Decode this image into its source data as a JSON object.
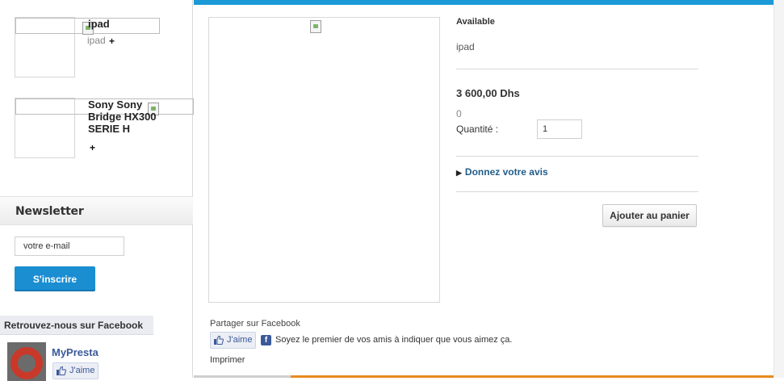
{
  "sidebar": {
    "products": [
      {
        "title": "ipad",
        "subtitle": "ipad",
        "action": "+"
      },
      {
        "title": "Sony Sony Bridge HX300 SERIE H",
        "action": "+"
      }
    ],
    "newsletter": {
      "title": "Newsletter",
      "email_value": "votre e-mail",
      "subscribe_label": "S'inscrire"
    },
    "facebook": {
      "title": "Retrouvez-nous sur Facebook",
      "page_name": "MyPresta",
      "like_label": "J'aime"
    }
  },
  "product": {
    "availability": "Available",
    "short_description": "ipad",
    "price": "3 600,00 Dhs",
    "reference": "0",
    "quantity_label": "Quantité :",
    "quantity_value": "1",
    "review_link": "Donnez votre avis",
    "add_to_cart": "Ajouter au panier"
  },
  "share": {
    "label": "Partager sur Facebook",
    "like_label": "J'aime",
    "social_text": "Soyez le premier de vos amis à indiquer que vous aimez ça.",
    "print_label": "Imprimer"
  },
  "colors": {
    "accent_blue": "#1b9ad6",
    "subscribe_button": "#1b8ed2",
    "link_blue": "#215d8a",
    "facebook_blue": "#3b5998",
    "bottom_accent": "#e98b1d"
  }
}
